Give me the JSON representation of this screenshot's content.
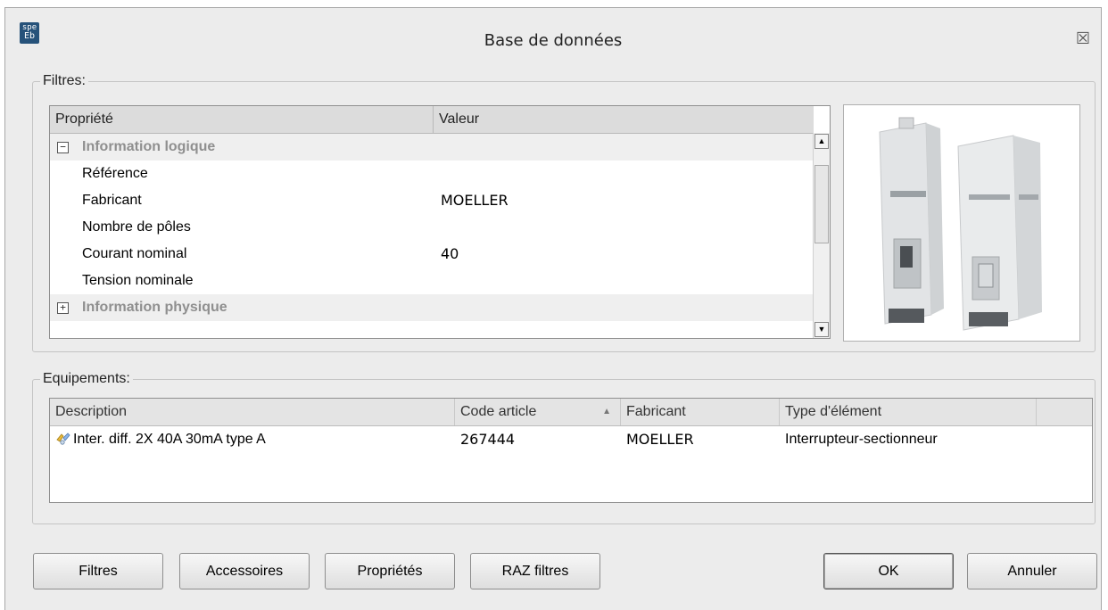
{
  "window": {
    "title": "Base de données",
    "icon_text_top": "spe",
    "icon_text_bottom": "Eb",
    "close_glyph": "☒"
  },
  "filters": {
    "label": "Filtres:",
    "grid": {
      "col_property": "Propriété",
      "col_value": "Valeur",
      "rows": [
        {
          "type": "category",
          "expander": "−",
          "name": "Information logique"
        },
        {
          "type": "property",
          "name": "Référence",
          "value": ""
        },
        {
          "type": "property",
          "name": "Fabricant",
          "value": "MOELLER"
        },
        {
          "type": "property",
          "name": "Nombre de pôles",
          "value": ""
        },
        {
          "type": "property",
          "name": "Courant nominal",
          "value": "40"
        },
        {
          "type": "property",
          "name": "Tension nominale",
          "value": ""
        },
        {
          "type": "category",
          "expander": "+",
          "name": "Information physique"
        }
      ]
    }
  },
  "equipment": {
    "label": "Equipements:",
    "columns": [
      "Description",
      "Code article",
      "Fabricant",
      "Type d'élément"
    ],
    "rows": [
      {
        "description": "Inter. diff. 2X 40A 30mA type A",
        "code": "267444",
        "manufacturer": "MOELLER",
        "type": "Interrupteur-sectionneur",
        "icon": "equipment-icon"
      }
    ]
  },
  "buttons": {
    "filters": "Filtres",
    "accessories": "Accessoires",
    "properties": "Propriétés",
    "reset_filters": "RAZ filtres",
    "ok": "OK",
    "cancel": "Annuler"
  }
}
